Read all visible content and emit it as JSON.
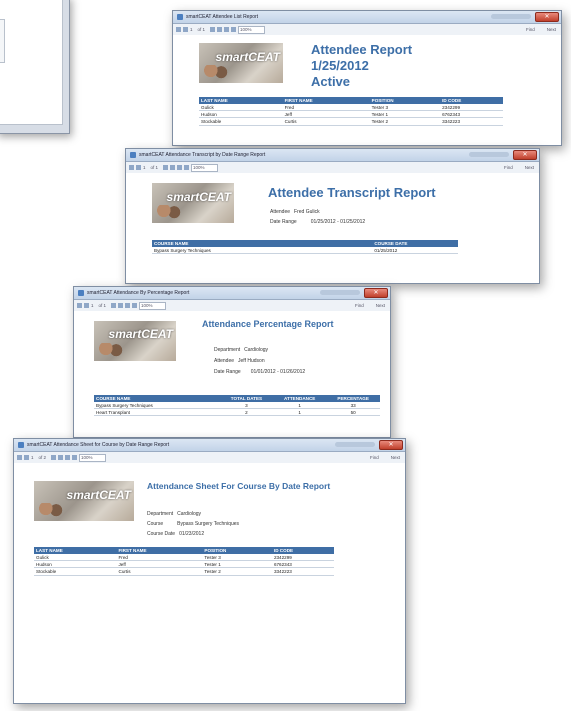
{
  "windows": [
    {
      "title": "smartCEAT Attendee List Report",
      "toolbar": {
        "page": "1",
        "of": "of 1",
        "zoom": "100%",
        "find": "Find",
        "next": "Next"
      },
      "report": {
        "logo_text": "smartCEAT",
        "title_lines": [
          "Attendee Report",
          "1/25/2012",
          "Active"
        ],
        "columns": [
          "LAST NAME",
          "FIRST NAME",
          "POSITION",
          "ID CODE"
        ],
        "rows": [
          [
            "Gulick",
            "Fred",
            "Tester 3",
            "2342299"
          ],
          [
            "Hudson",
            "Jeff",
            "Tester 1",
            "6762343"
          ],
          [
            "Stockable",
            "Curtis",
            "Tester 2",
            "3342223"
          ]
        ]
      }
    },
    {
      "title": "smartCEAT Attendance Transcript by Date Range Report",
      "toolbar": {
        "page": "1",
        "of": "of 1",
        "zoom": "100%",
        "find": "Find",
        "next": "Next"
      },
      "report": {
        "logo_text": "smartCEAT",
        "title": "Attendee Transcript Report",
        "meta": [
          {
            "k": "Attendee",
            "v": "Fred Gulick"
          },
          {
            "k": "Date Range",
            "v": "01/25/2012  -  01/25/2012"
          }
        ],
        "columns": [
          "COURSE NAME",
          "COURSE DATE"
        ],
        "rows": [
          [
            "Bypass Surgery Techniques",
            "01/25/2012"
          ]
        ]
      }
    },
    {
      "title": "smartCEAT Attendance By Percentage Report",
      "toolbar": {
        "page": "1",
        "of": "of 1",
        "zoom": "100%",
        "find": "Find",
        "next": "Next"
      },
      "report": {
        "logo_text": "smartCEAT",
        "title": "Attendance Percentage Report",
        "meta": [
          {
            "k": "Department",
            "v": "Cardiology"
          },
          {
            "k": "Attendee",
            "v": "Jeff Hudson"
          },
          {
            "k": "Date Range",
            "v": "01/01/2012  -  01/26/2012"
          }
        ],
        "columns": [
          "COURSE NAME",
          "TOTAL DATES",
          "ATTENDANCE",
          "PERCENTAGE"
        ],
        "rows": [
          [
            "Bypass Surgery Techniques",
            "3",
            "1",
            "33"
          ],
          [
            "Heart Transplant",
            "2",
            "1",
            "50"
          ]
        ]
      }
    },
    {
      "title": "smartCEAT Attendance Sheet for Course by Date Range Report",
      "toolbar": {
        "page": "1",
        "of": "of 2",
        "zoom": "100%",
        "find": "Find",
        "next": "Next"
      },
      "report": {
        "logo_text": "smartCEAT",
        "title": "Attendance Sheet For Course By Date Report",
        "meta": [
          {
            "k": "Department",
            "v": "Cardiology"
          },
          {
            "k": "Course",
            "v": "Bypass Surgery Techniques"
          },
          {
            "k": "Course Date",
            "v": "01/23/2012"
          }
        ],
        "columns": [
          "LAST NAME",
          "FIRST NAME",
          "POSITION",
          "ID CODE"
        ],
        "rows": [
          [
            "Gulick",
            "Fred",
            "Tester 3",
            "2342299"
          ],
          [
            "Hudson",
            "Jeff",
            "Tester 1",
            "6762343"
          ],
          [
            "Stockable",
            "Curtis",
            "Tester 2",
            "3342223"
          ]
        ]
      }
    }
  ]
}
